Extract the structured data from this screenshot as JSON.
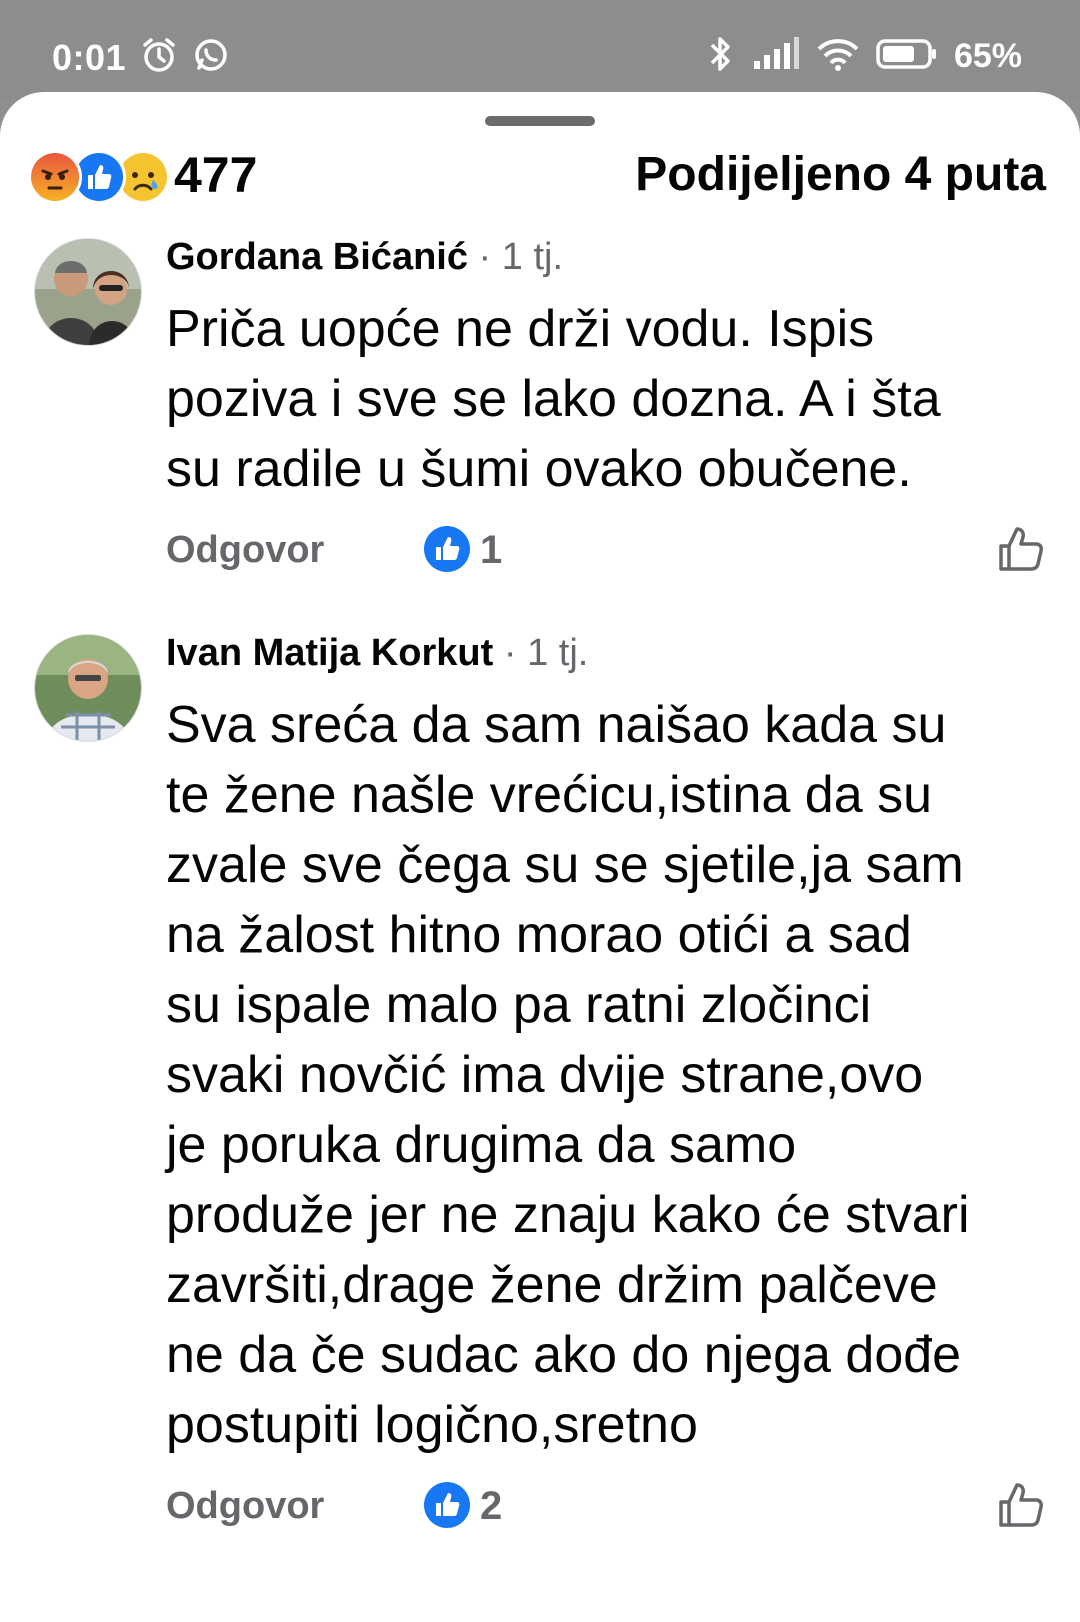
{
  "status_bar": {
    "time": "0:01",
    "battery": "65%",
    "icons": [
      "alarm-icon",
      "whatsapp-icon",
      "bluetooth-icon",
      "signal-icon",
      "wifi-icon",
      "battery-icon"
    ]
  },
  "summary": {
    "reaction_icons": [
      "angry-reaction-icon",
      "like-reaction-icon",
      "sad-reaction-icon"
    ],
    "reaction_count": "477",
    "share_count": "Podijeljeno 4 puta"
  },
  "comments": [
    {
      "author": "Gordana Bićanić",
      "time": " · 1 tj.",
      "lines": [
        "Priča uopće ne drži vodu. Ispis",
        "poziva i sve se lako dozna. A i šta",
        "su radile u šumi ovako obučene."
      ],
      "reply_label": "Odgovor",
      "like_count": "1"
    },
    {
      "author": "Ivan Matija Korkut",
      "time": " · 1 tj.",
      "lines": [
        "Sva sreća da sam naišao kada su",
        "te žene našle vrećicu,istina da su",
        "zvale sve čega su se sjetile,ja sam",
        "na žalost hitno morao otići  a sad",
        "su ispale malo pa ratni zločinci",
        "svaki novčić ima dvije strane,ovo",
        "je poruka drugima da samo",
        "produže jer ne znaju kako će stvari",
        "završiti,drage žene držim palčeve",
        "ne da če sudac ako do njega dođe",
        "postupiti logično,sretno"
      ],
      "reply_label": "Odgovor",
      "like_count": "2"
    }
  ],
  "colors": {
    "facebook_blue": "#1877f2",
    "secondary_text": "#65676b",
    "status_bar_bg": "#8d8d8d"
  }
}
